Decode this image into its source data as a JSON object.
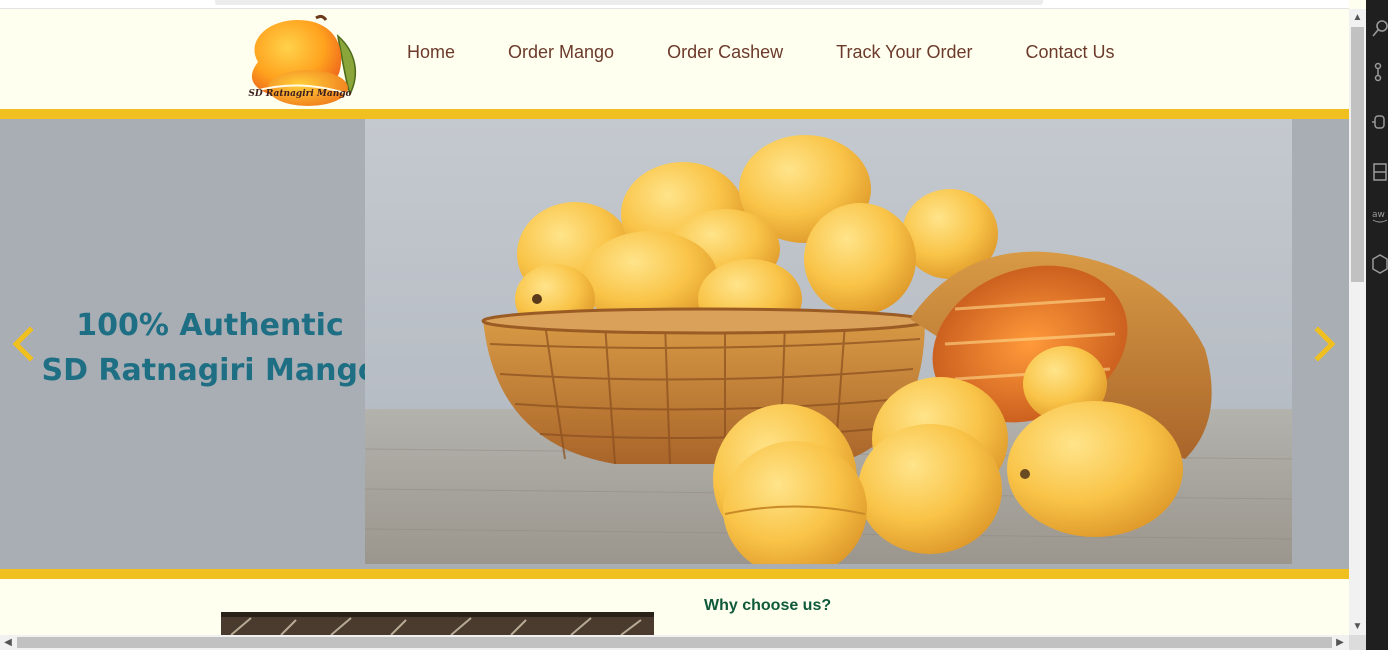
{
  "brand": {
    "logo_text": "SD Ratnagiri Mango",
    "colors": {
      "background": "#fffff0",
      "accent_bar": "#f0c020",
      "nav_text": "#6b3a2a",
      "hero_text": "#1e6f84",
      "heading_green": "#0f5a3a"
    }
  },
  "nav": {
    "items": [
      {
        "label": "Home"
      },
      {
        "label": "Order Mango"
      },
      {
        "label": "Order Cashew"
      },
      {
        "label": "Track Your Order"
      },
      {
        "label": "Contact Us"
      }
    ]
  },
  "hero": {
    "title_line1": "100% Authentic",
    "title_line2": "SD Ratnagiri Mango",
    "prev_icon": "chevron-left-icon",
    "next_icon": "chevron-right-icon"
  },
  "content": {
    "why_heading": "Why choose us?"
  },
  "sidebar": {
    "icons": [
      "search-icon",
      "source-control-icon",
      "debug-icon",
      "extensions-icon",
      "aws-icon",
      "hexagon-icon"
    ]
  }
}
